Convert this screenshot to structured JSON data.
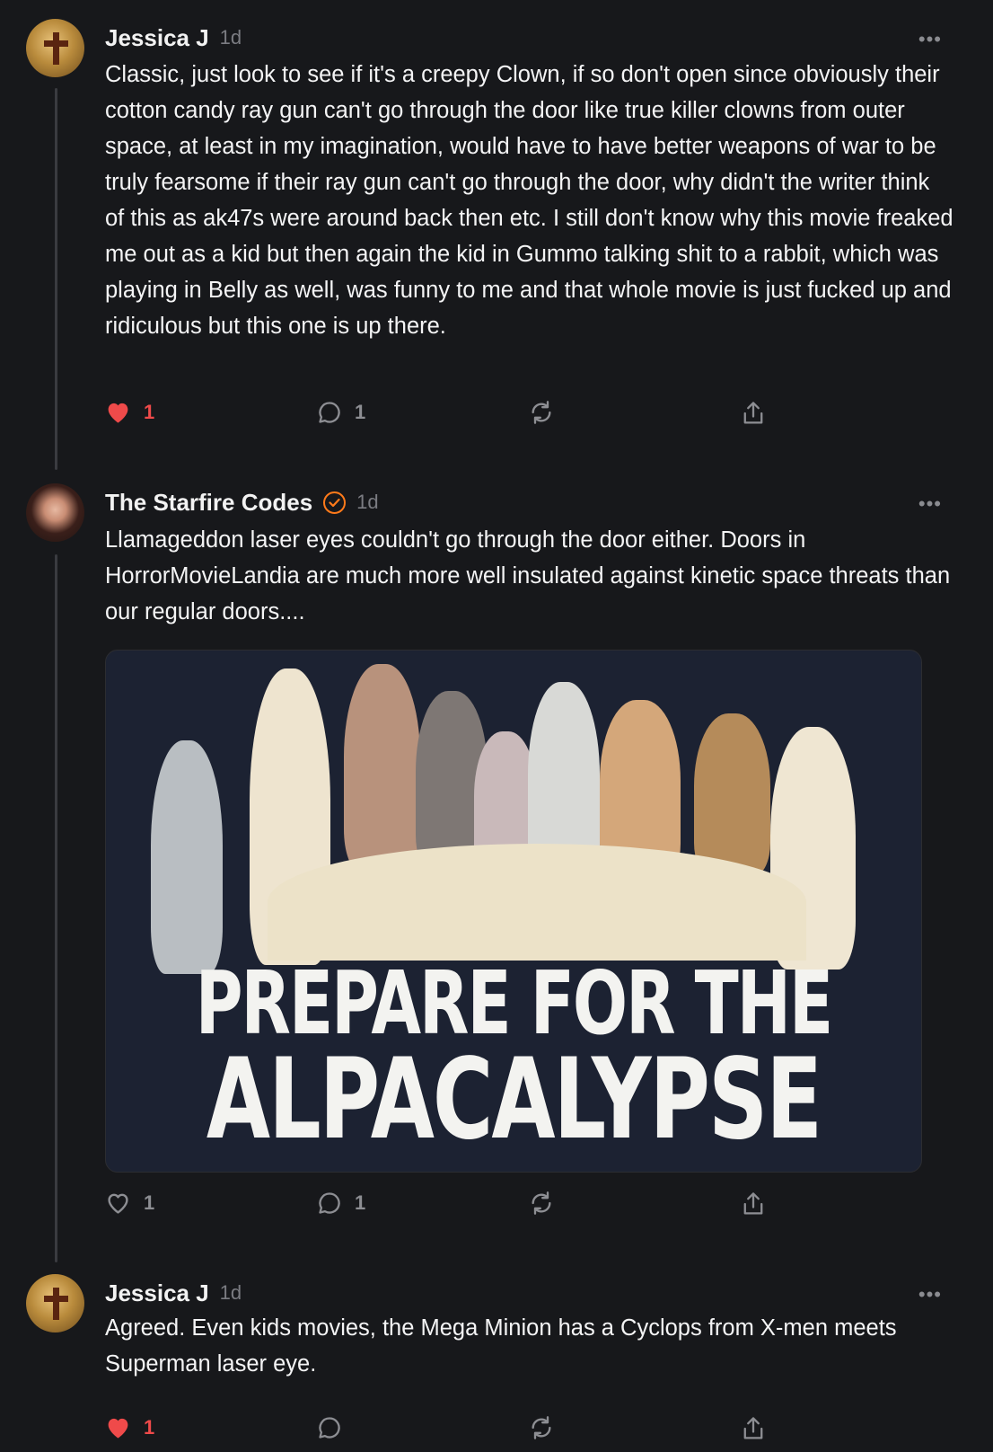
{
  "posts": [
    {
      "author": "Jessica J",
      "time": "1d",
      "avatar_icon": "cross-avatar",
      "text": "Classic, just look to see if it's a creepy Clown, if so don't open since obviously their cotton candy ray gun can't go through the door like true killer clowns from outer space, at least in my imagination, would have to have better weapons of war to be truly fearsome if their ray gun can't go through the door, why didn't the writer think of this as ak47s were around back then etc. I still don't know why this movie freaked me out as a kid but then again the kid in Gummo talking shit to a rabbit, which was playing in Belly as well, was funny to me and that whole movie is just fucked up and ridiculous but this one is up there.",
      "likes": "1",
      "liked": true,
      "replies": "1"
    },
    {
      "author": "The Starfire Codes",
      "verified": true,
      "time": "1d",
      "avatar_icon": "profile-photo",
      "text": "Llamageddon laser eyes couldn't go through the door either. Doors in HorrorMovieLandia are much more well insulated against kinetic space threats than our regular doors....",
      "image": {
        "line1": "PREPARE FOR THE",
        "line2": "ALPACALYPSE"
      },
      "likes": "1",
      "liked": false,
      "replies": "1"
    },
    {
      "author": "Jessica J",
      "time": "1d",
      "avatar_icon": "cross-avatar",
      "text": "Agreed. Even kids movies, the Mega Minion has a Cyclops from X-men meets Superman laser eye.",
      "likes": "1",
      "liked": true,
      "replies": ""
    }
  ],
  "more_label": "•••",
  "colors": {
    "background": "#17181b",
    "like_red": "#ef4a4a",
    "verified_orange": "#ff7a1a",
    "muted": "#8d8e93"
  }
}
